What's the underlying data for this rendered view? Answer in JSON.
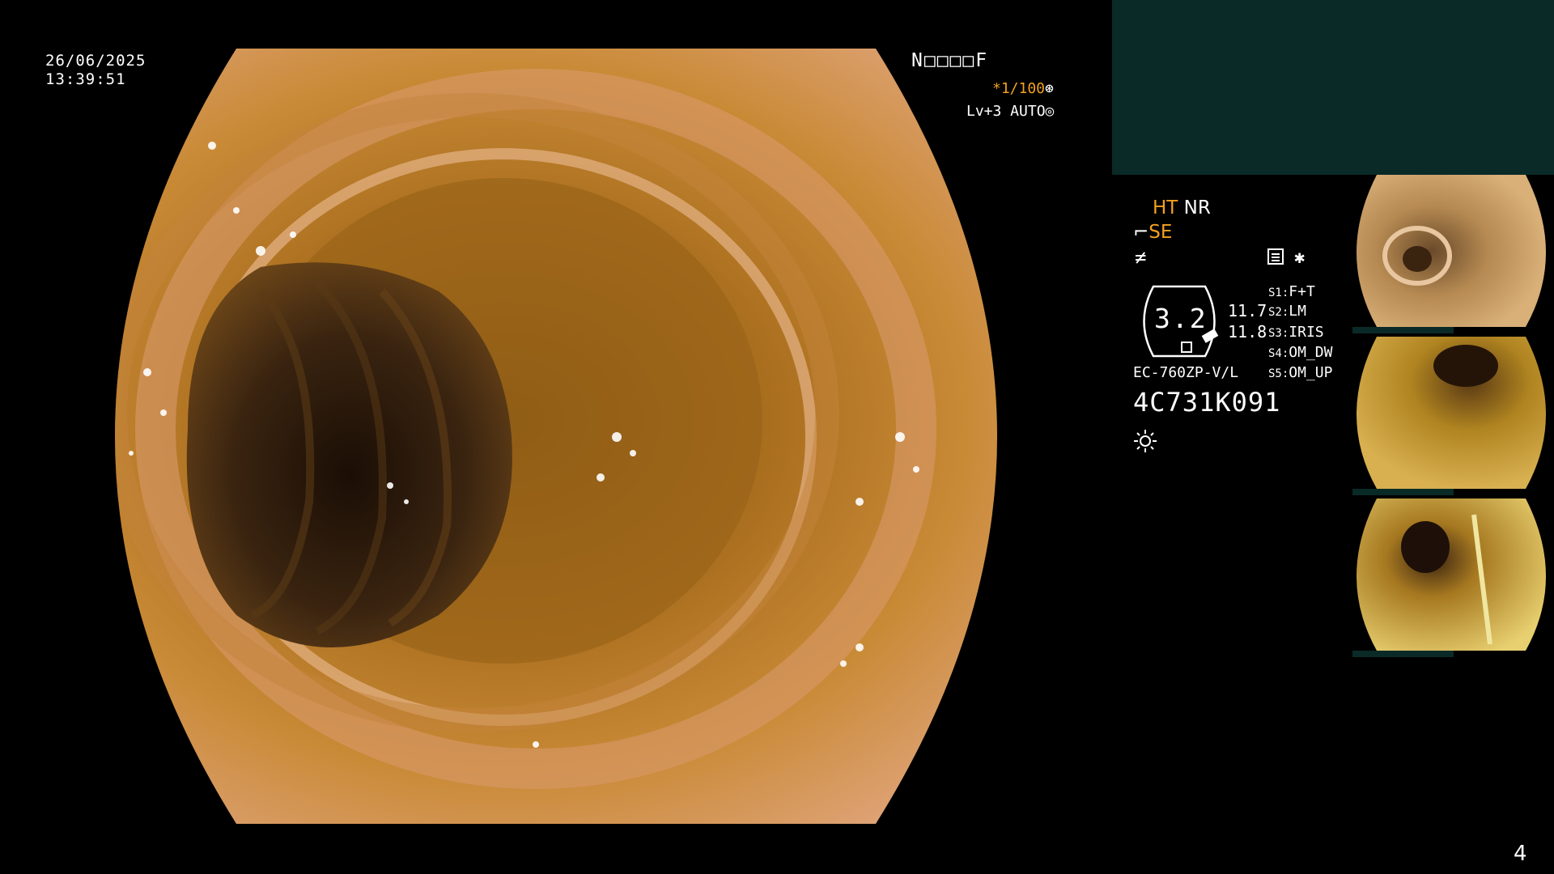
{
  "overlay": {
    "date": "26/06/2025",
    "time": "13:39:51",
    "patient_id": "N□□□□F",
    "shutter": "*1/100",
    "level": "Lv+3 AUTO"
  },
  "panel": {
    "ht": "HT",
    "nr": "NR",
    "se": "SE",
    "zoom": "3.2",
    "value_a": "11.7",
    "value_b": "11.8",
    "switches": [
      {
        "key": "S1:",
        "label": "F+T"
      },
      {
        "key": "S2:",
        "label": "LM"
      },
      {
        "key": "S3:",
        "label": "IRIS"
      },
      {
        "key": "S4:",
        "label": "OM_DW"
      },
      {
        "key": "S5:",
        "label": "OM_UP"
      }
    ],
    "scope_model": "EC-760ZP-V/L",
    "scope_serial": "4C731K091"
  },
  "icons": {
    "shutter_icon": "aperture-icon",
    "level_icon": "target-icon",
    "light_icon": "sun-icon",
    "record_icon": "record-icon",
    "scope_icon": "scope-icon"
  },
  "colors": {
    "accent": "#f2a020",
    "panel_bg": "#0a2a27"
  },
  "page_number": "4"
}
